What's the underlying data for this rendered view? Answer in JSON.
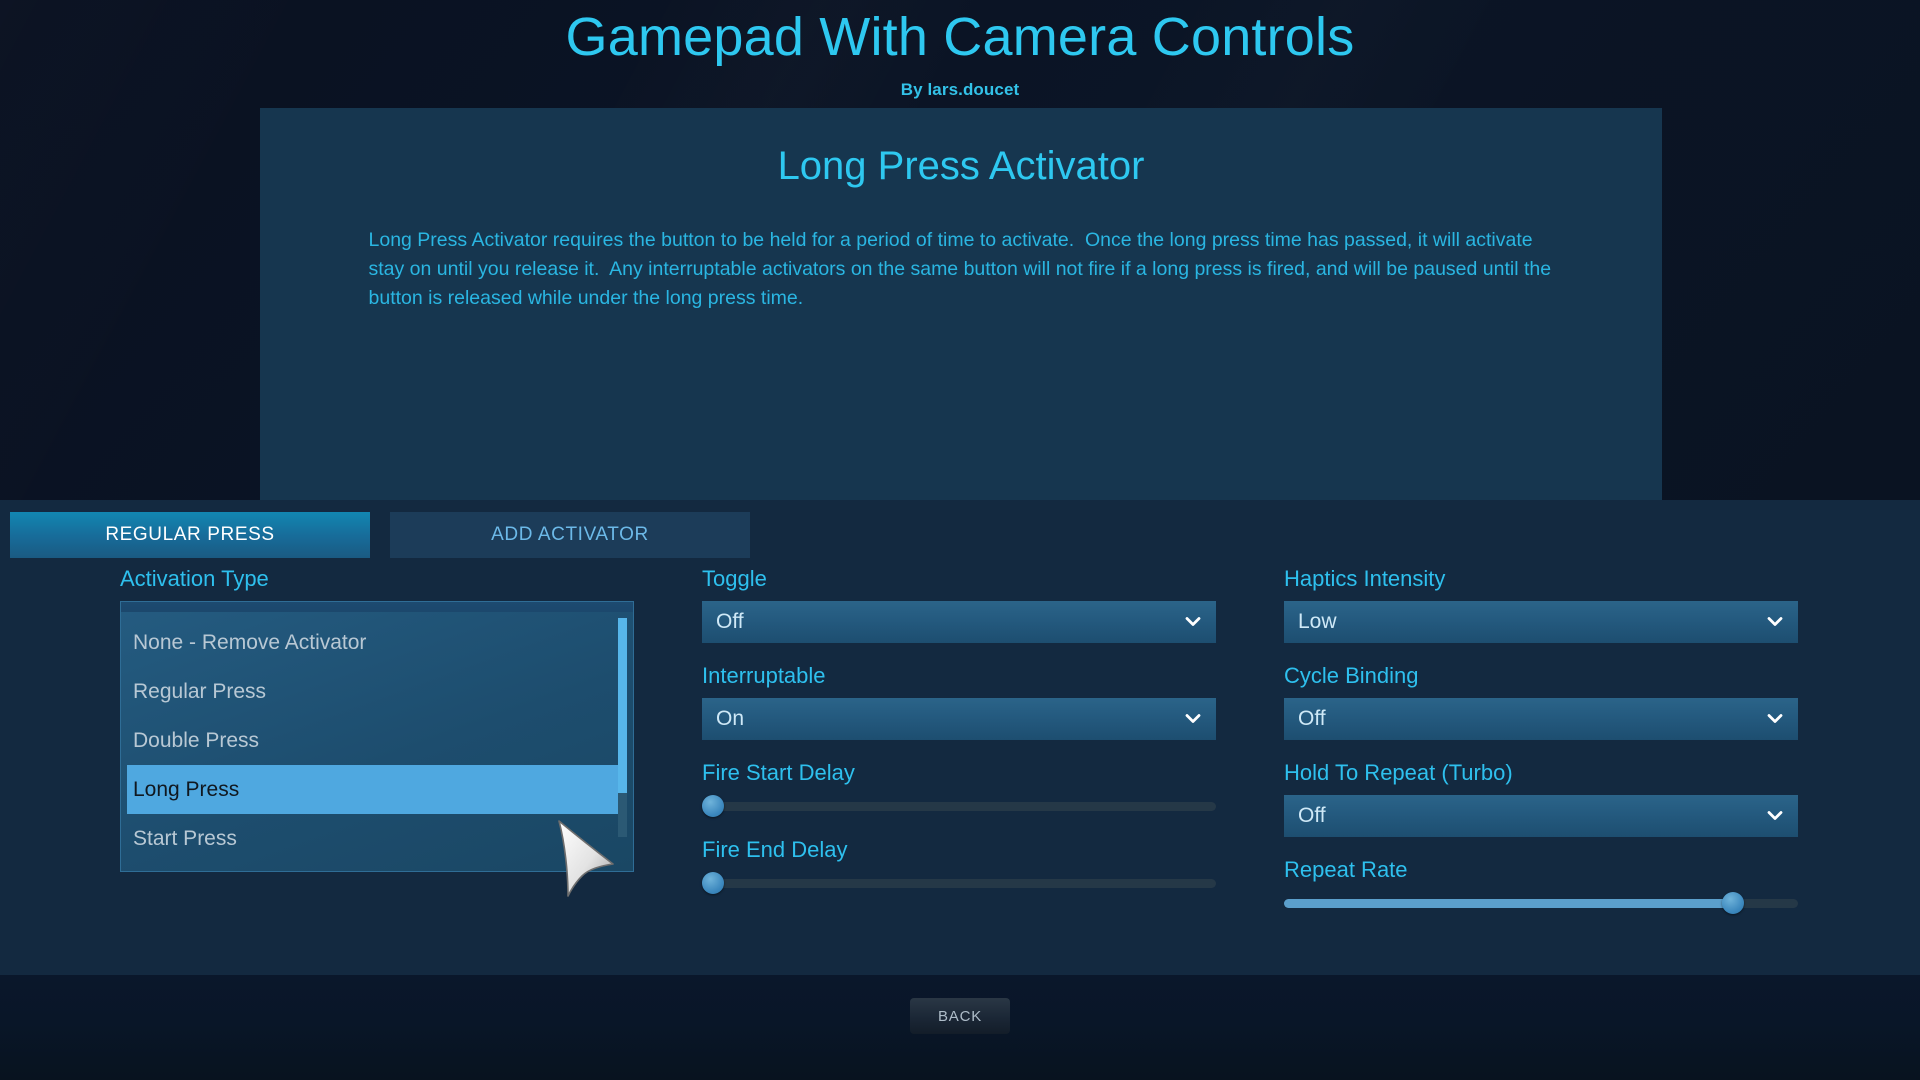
{
  "header": {
    "title": "Gamepad With Camera Controls",
    "author": "By lars.doucet"
  },
  "description_panel": {
    "title": "Long Press Activator",
    "body": "Long Press Activator requires the button to be held for a period of time to activate.  Once the long press time has passed, it will activate stay on until you release it.  Any interruptable activators on the same button will not fire if a long press is fired, and will be paused until the button is released while under the long press time."
  },
  "tabs": [
    {
      "label": "REGULAR PRESS",
      "active": true
    },
    {
      "label": "ADD ACTIVATOR",
      "active": false
    }
  ],
  "columns": {
    "left": {
      "activation_type": {
        "label": "Activation Type",
        "value": "Regular Press",
        "chevron_icon": "chevron-down-icon",
        "open": true,
        "options": [
          {
            "label": "None - Remove Activator",
            "selected": false
          },
          {
            "label": "Regular Press",
            "selected": false
          },
          {
            "label": "Double Press",
            "selected": false
          },
          {
            "label": "Long Press",
            "selected": true
          },
          {
            "label": "Start Press",
            "selected": false
          }
        ]
      }
    },
    "middle": {
      "toggle": {
        "label": "Toggle",
        "value": "Off",
        "chevron_icon": "chevron-down-icon"
      },
      "interruptable": {
        "label": "Interruptable",
        "value": "On",
        "chevron_icon": "chevron-down-icon"
      },
      "fire_start_delay": {
        "label": "Fire Start Delay",
        "percent": 0
      },
      "fire_end_delay": {
        "label": "Fire End Delay",
        "percent": 0
      }
    },
    "right": {
      "haptics_intensity": {
        "label": "Haptics Intensity",
        "value": "Low",
        "chevron_icon": "chevron-down-icon"
      },
      "cycle_binding": {
        "label": "Cycle Binding",
        "value": "Off",
        "chevron_icon": "chevron-down-icon"
      },
      "hold_to_repeat": {
        "label": "Hold To Repeat (Turbo)",
        "value": "Off",
        "chevron_icon": "chevron-down-icon"
      },
      "repeat_rate": {
        "label": "Repeat Rate",
        "percent": 89
      }
    }
  },
  "footer": {
    "back_label": "BACK"
  },
  "cursor": {
    "icon": "mouse-pointer-icon"
  },
  "colors": {
    "accent_cyan": "#2ec8f0",
    "panel_bg": "#16364f",
    "mid_bg": "#132940",
    "page_bg": "#0a1121",
    "highlight_blue": "#4fa8e0",
    "tab_active_blue": "#1287b2"
  }
}
